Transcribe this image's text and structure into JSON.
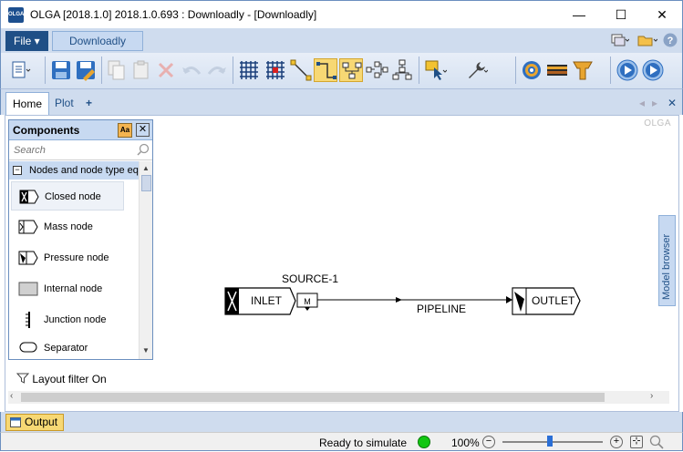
{
  "window": {
    "title": "OLGA [2018.1.0] 2018.1.0.693 : Downloadly - [Downloadly]",
    "app_icon_text": "OLGA",
    "minimize": "—",
    "maximize": "☐",
    "close": "✕"
  },
  "menu": {
    "file_label": "File ▾",
    "ribbon_tab": "Downloadly"
  },
  "tabs": {
    "home": "Home",
    "plot": "Plot",
    "add": "+",
    "nav_prev": "◂",
    "nav_next": "▸",
    "close": "✕"
  },
  "canvas": {
    "watermark": "OLGA"
  },
  "components": {
    "title": "Components",
    "aa": "Aa",
    "close": "✕",
    "search_placeholder": "Search",
    "group_toggle": "−",
    "group_label": "Nodes and node type eq",
    "items": [
      {
        "label": "Closed node"
      },
      {
        "label": "Mass node"
      },
      {
        "label": "Pressure node"
      },
      {
        "label": "Internal node"
      },
      {
        "label": "Junction node"
      },
      {
        "label": "Separator"
      }
    ]
  },
  "layout_filter": "Layout filter On",
  "model_browser": "Model browser",
  "diagram": {
    "inlet": "INLET",
    "source": "SOURCE-1",
    "source_mark": "M",
    "pipeline": "PIPELINE",
    "outlet": "OUTLET"
  },
  "output": {
    "label": "Output"
  },
  "status": {
    "text": "Ready to simulate",
    "zoom": "100%",
    "zoom_out": "−",
    "zoom_in": "+",
    "fit": "⊹",
    "zoom_level": 0.47
  }
}
